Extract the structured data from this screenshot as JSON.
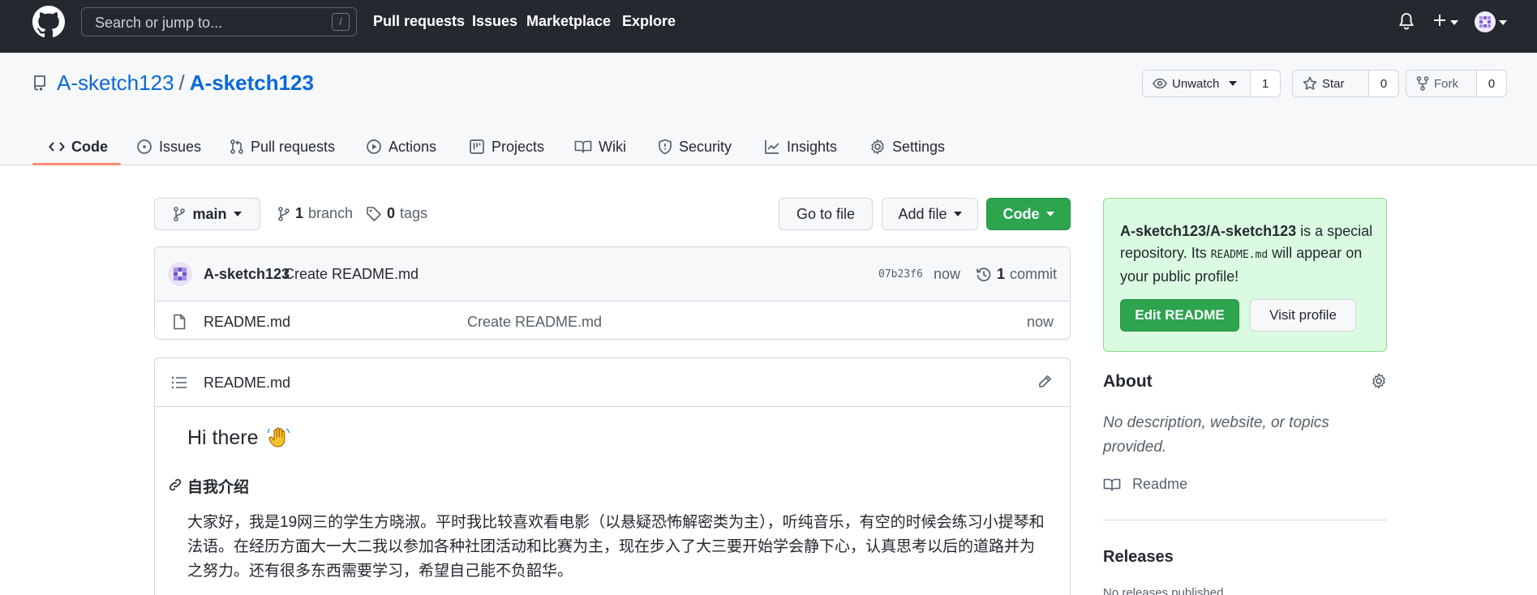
{
  "header": {
    "search_placeholder": "Search or jump to...",
    "search_shortcut": "/",
    "nav": [
      "Pull requests",
      "Issues",
      "Marketplace",
      "Explore"
    ]
  },
  "repo": {
    "owner": "A-sketch123",
    "separator": "/",
    "name": "A-sketch123",
    "watch_label": "Unwatch",
    "watch_count": "1",
    "star_label": "Star",
    "star_count": "0",
    "fork_label": "Fork",
    "fork_count": "0"
  },
  "tabs": [
    "Code",
    "Issues",
    "Pull requests",
    "Actions",
    "Projects",
    "Wiki",
    "Security",
    "Insights",
    "Settings"
  ],
  "toolbar": {
    "branch_label": "main",
    "branch_count": "1",
    "branch_word": "branch",
    "tag_count": "0",
    "tag_word": "tags",
    "go_to_file": "Go to file",
    "add_file": "Add file",
    "code": "Code"
  },
  "commit": {
    "author": "A-sketch123",
    "message": "Create README.md",
    "hash": "07b23f6",
    "time": "now",
    "history_count": "1",
    "history_word": "commit"
  },
  "files": [
    {
      "name": "README.md",
      "message": "Create README.md",
      "time": "now"
    }
  ],
  "readme": {
    "title": "README.md",
    "heading": "Hi there",
    "section_heading": "自我介绍",
    "paragraph": "大家好，我是19网三的学生方晓淑。平时我比较喜欢看电影（以悬疑恐怖解密类为主），听纯音乐，有空的时候会练习小提琴和法语。在经历方面大一大二我以参加各种社团活动和比赛为主，现在步入了大三要开始学会静下心，认真思考以后的道路并为之努力。还有很多东西需要学习，希望自己能不负韶华。"
  },
  "sidebar": {
    "special_repo": "A-sketch123/A-sketch123",
    "special_text_1": " is a special repository. Its ",
    "special_code": "README.md",
    "special_text_2": " will appear on your public profile!",
    "edit_readme": "Edit README",
    "visit_profile": "Visit profile",
    "about_title": "About",
    "about_desc": "No description, website, or topics provided.",
    "readme_link": "Readme",
    "releases_title": "Releases",
    "releases_note": "No releases published"
  },
  "colors": {
    "header_bg": "#24292f",
    "link": "#0969da",
    "green": "#2da44e",
    "tab_underline": "#fd8c73",
    "special_bg": "#dafbe1"
  }
}
